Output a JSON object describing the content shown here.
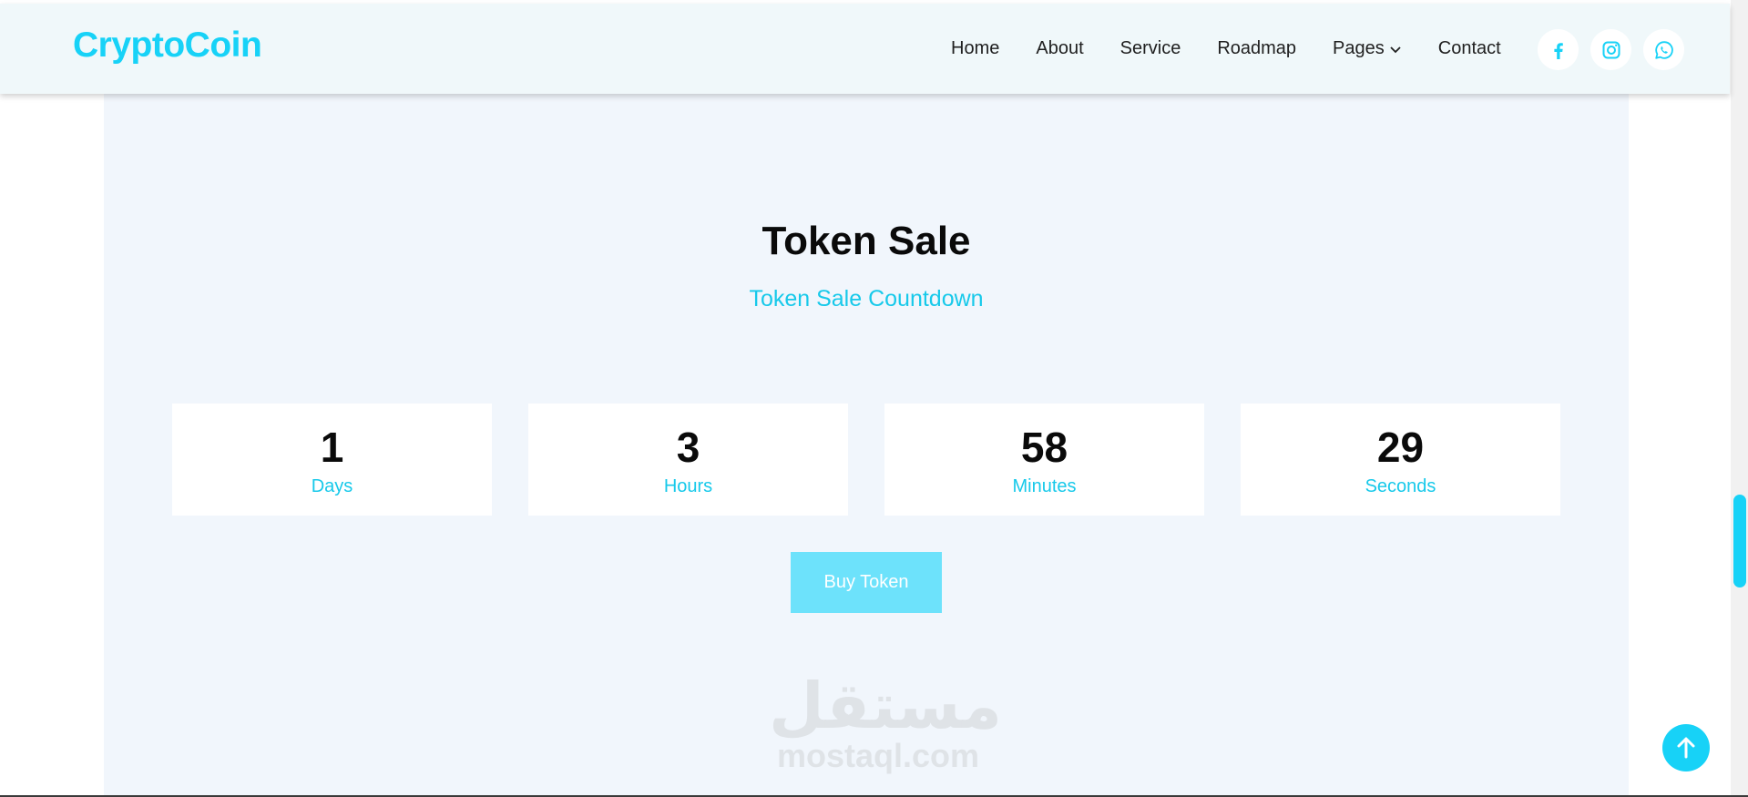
{
  "header": {
    "brand": "CryptoCoin",
    "nav": [
      "Home",
      "About",
      "Service",
      "Roadmap",
      "Pages",
      "Contact"
    ],
    "socials": [
      "facebook-icon",
      "instagram-icon",
      "whatsapp-icon"
    ]
  },
  "hero": {
    "title": "Token Sale",
    "subtitle": "Token Sale Countdown"
  },
  "countdown": [
    {
      "value": "1",
      "label": "Days"
    },
    {
      "value": "3",
      "label": "Hours"
    },
    {
      "value": "58",
      "label": "Minutes"
    },
    {
      "value": "29",
      "label": "Seconds"
    }
  ],
  "buy_button": "Buy Token",
  "watermark": {
    "arabic": "مستقل",
    "latin": "mostaql.com"
  },
  "colors": {
    "accent": "#17d2f7",
    "accent_text": "#17c9ea",
    "button": "#6de2fb",
    "section_bg": "#f1f6fc",
    "header_bg": "#f0f8fa"
  }
}
